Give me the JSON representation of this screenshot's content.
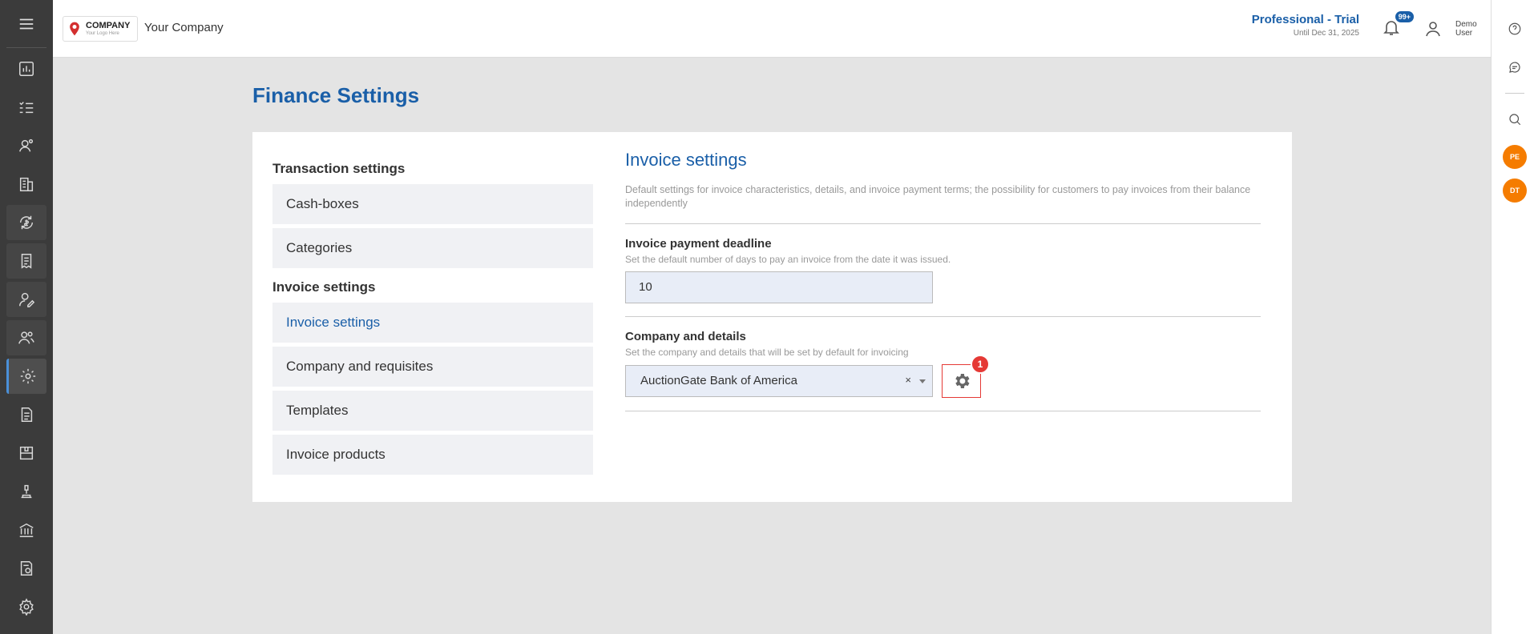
{
  "header": {
    "logo_brand": "COMPANY",
    "logo_tagline": "Your Logo Here",
    "company_name": "Your Company",
    "plan_name": "Professional - Trial",
    "plan_until": "Until Dec 31, 2025",
    "notifications_badge": "99+",
    "user_name": "Demo User"
  },
  "leftnav": {
    "icons": [
      "menu-icon",
      "dashboard-icon",
      "tasks-icon",
      "users-icon",
      "buildings-icon",
      "finance-icon",
      "receipt-icon",
      "user-edit-icon",
      "team-icon",
      "finance-settings-icon",
      "document-icon",
      "warehouse-icon",
      "auction-icon",
      "bank-icon",
      "report-icon",
      "settings-icon"
    ],
    "active": "finance-settings-icon"
  },
  "rightrail": {
    "avatars": [
      "PE",
      "DT"
    ],
    "avatar_color": "#f57c00"
  },
  "page": {
    "title": "Finance Settings"
  },
  "menu": {
    "section1": "Transaction settings",
    "section1_items": [
      "Cash-boxes",
      "Categories"
    ],
    "section2": "Invoice settings",
    "section2_items": [
      "Invoice settings",
      "Company and requisites",
      "Templates",
      "Invoice products"
    ],
    "selected": "Invoice settings"
  },
  "panel": {
    "title": "Invoice settings",
    "description": "Default settings for invoice characteristics, details, and invoice payment terms; the possibility for customers to pay invoices from their balance independently",
    "deadline": {
      "label": "Invoice payment deadline",
      "hint": "Set the default number of days to pay an invoice from the date it was issued.",
      "value": "10"
    },
    "company": {
      "label": "Company and details",
      "hint": "Set the company and details that will be set by default for invoicing",
      "value": "AuctionGate Bank of America",
      "clear_symbol": "×",
      "badge": "1"
    }
  },
  "colors": {
    "accent": "#1a5fa8",
    "highlight_border": "#e53935"
  }
}
